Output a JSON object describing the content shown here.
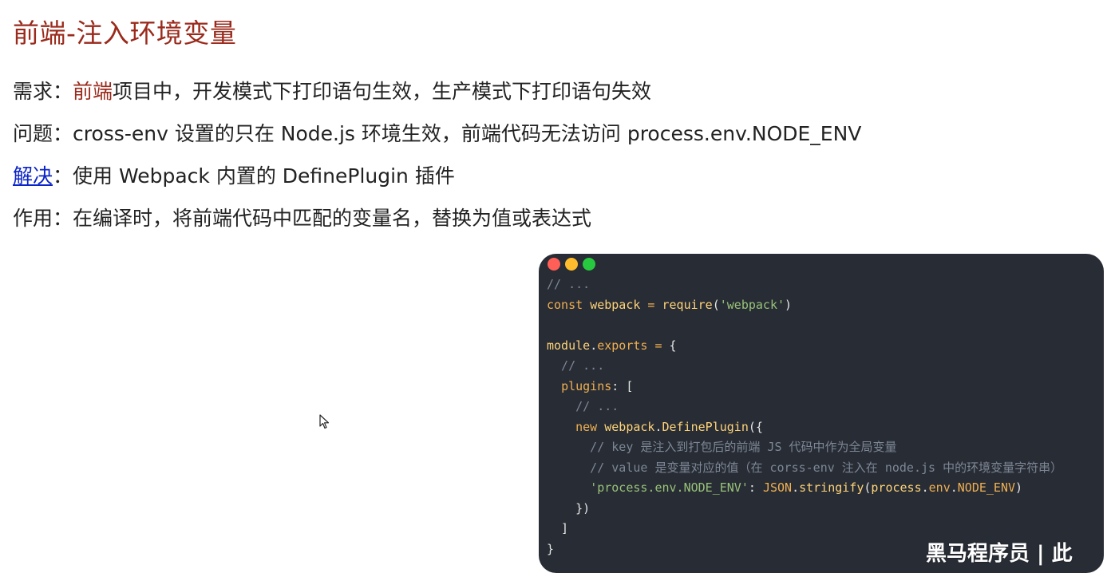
{
  "slide": {
    "title": "前端-注入环境变量",
    "requirement": {
      "label": "需求：",
      "accent": "前端",
      "text": "项目中，开发模式下打印语句生效，生产模式下打印语句失效"
    },
    "problem": {
      "label": "问题：",
      "text": "cross-env 设置的只在 Node.js 环境生效，前端代码无法访问 process.env.NODE_ENV"
    },
    "solution": {
      "link": "解决",
      "text": "：使用 Webpack 内置的 DefinePlugin 插件"
    },
    "effect": {
      "label": "作用：",
      "text": "在编译时，将前端代码中匹配的变量名，替换为值或表达式"
    }
  },
  "code_window": {
    "lines": [
      [
        {
          "t": "// ...",
          "c": "com"
        }
      ],
      [
        {
          "t": "const ",
          "c": "kw"
        },
        {
          "t": "webpack",
          "c": "id"
        },
        {
          "t": " = ",
          "c": "kw"
        },
        {
          "t": "require",
          "c": "fn"
        },
        {
          "t": "(",
          "c": "pun"
        },
        {
          "t": "'webpack'",
          "c": "str"
        },
        {
          "t": ")",
          "c": "pun"
        }
      ],
      [],
      [
        {
          "t": "module",
          "c": "id"
        },
        {
          "t": ".",
          "c": "pun"
        },
        {
          "t": "exports",
          "c": "kw"
        },
        {
          "t": " = ",
          "c": "kw"
        },
        {
          "t": "{",
          "c": "pun"
        }
      ],
      [
        {
          "t": "  // ...",
          "c": "com"
        }
      ],
      [
        {
          "t": "  ",
          "c": "pun"
        },
        {
          "t": "plugins",
          "c": "kw"
        },
        {
          "t": ": [",
          "c": "pun"
        }
      ],
      [
        {
          "t": "    // ...",
          "c": "com"
        }
      ],
      [
        {
          "t": "    ",
          "c": "pun"
        },
        {
          "t": "new ",
          "c": "kw"
        },
        {
          "t": "webpack",
          "c": "id"
        },
        {
          "t": ".",
          "c": "pun"
        },
        {
          "t": "DefinePlugin",
          "c": "fn"
        },
        {
          "t": "({",
          "c": "pun"
        }
      ],
      [
        {
          "t": "      // key 是注入到打包后的前端 JS 代码中作为全局变量",
          "c": "com"
        }
      ],
      [
        {
          "t": "      // value 是变量对应的值（在 corss-env 注入在 node.js 中的环境变量字符串）",
          "c": "com"
        }
      ],
      [
        {
          "t": "      ",
          "c": "pun"
        },
        {
          "t": "'process.env.NODE_ENV'",
          "c": "str"
        },
        {
          "t": ": ",
          "c": "pun"
        },
        {
          "t": "JSON",
          "c": "cn"
        },
        {
          "t": ".",
          "c": "pun"
        },
        {
          "t": "stringify",
          "c": "fn"
        },
        {
          "t": "(",
          "c": "pun"
        },
        {
          "t": "process",
          "c": "id"
        },
        {
          "t": ".",
          "c": "pun"
        },
        {
          "t": "env",
          "c": "kw"
        },
        {
          "t": ".",
          "c": "pun"
        },
        {
          "t": "NODE_ENV",
          "c": "cn"
        },
        {
          "t": ")",
          "c": "pun"
        }
      ],
      [
        {
          "t": "    })",
          "c": "pun"
        }
      ],
      [
        {
          "t": "  ]",
          "c": "pun"
        }
      ],
      [
        {
          "t": "}",
          "c": "pun"
        }
      ]
    ]
  },
  "watermark": "黑马程序员 | 此"
}
